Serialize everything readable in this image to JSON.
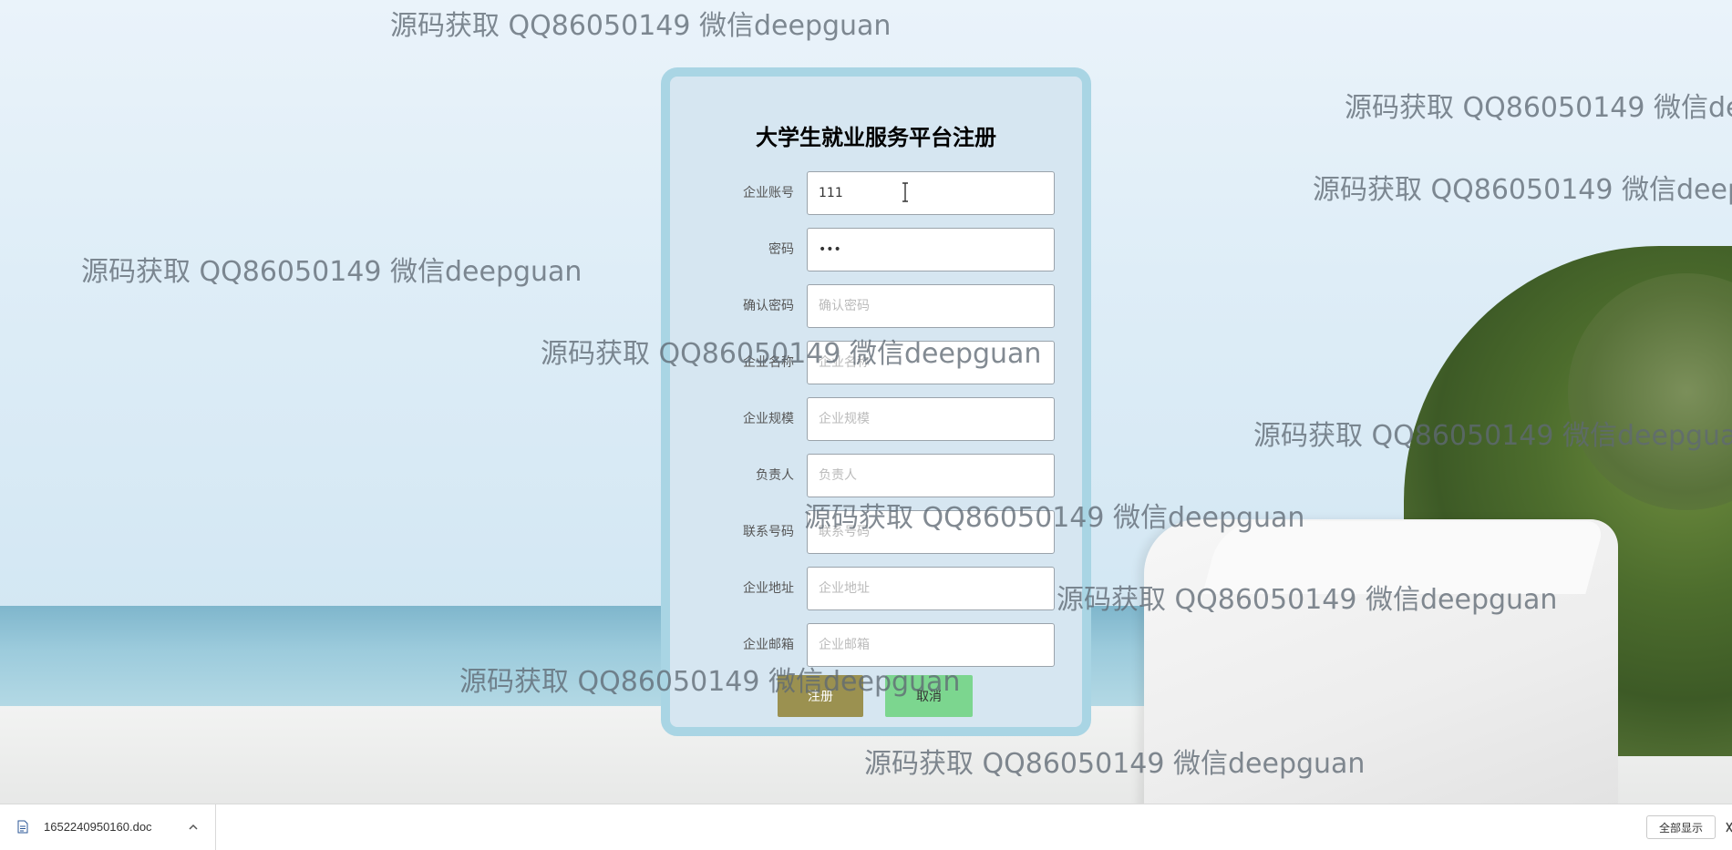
{
  "form": {
    "title": "大学生就业服务平台注册",
    "fields": [
      {
        "label": "企业账号",
        "value": "111",
        "placeholder": ""
      },
      {
        "label": "密码",
        "value": "•••",
        "placeholder": ""
      },
      {
        "label": "确认密码",
        "value": "",
        "placeholder": "确认密码"
      },
      {
        "label": "企业名称",
        "value": "",
        "placeholder": "企业名称"
      },
      {
        "label": "企业规模",
        "value": "",
        "placeholder": "企业规模"
      },
      {
        "label": "负责人",
        "value": "",
        "placeholder": "负责人"
      },
      {
        "label": "联系号码",
        "value": "",
        "placeholder": "联系号码"
      },
      {
        "label": "企业地址",
        "value": "",
        "placeholder": "企业地址"
      },
      {
        "label": "企业邮箱",
        "value": "",
        "placeholder": "企业邮箱"
      }
    ],
    "register_label": "注册",
    "cancel_label": "取消"
  },
  "watermark": {
    "text": "源码获取 QQ86050149 微信deepguan"
  },
  "download_bar": {
    "file_name": "1652240950160.doc",
    "show_all_label": "全部显示"
  },
  "icons": {
    "caret": "text-cursor-icon",
    "file": "doc-file-icon",
    "expand": "chevron-up-icon",
    "close": "close-icon"
  },
  "colors": {
    "card_border": "#a9d5e4",
    "card_bg": "#d6e6f1",
    "register_button": "#9b9150",
    "cancel_button": "#7cd68f"
  }
}
